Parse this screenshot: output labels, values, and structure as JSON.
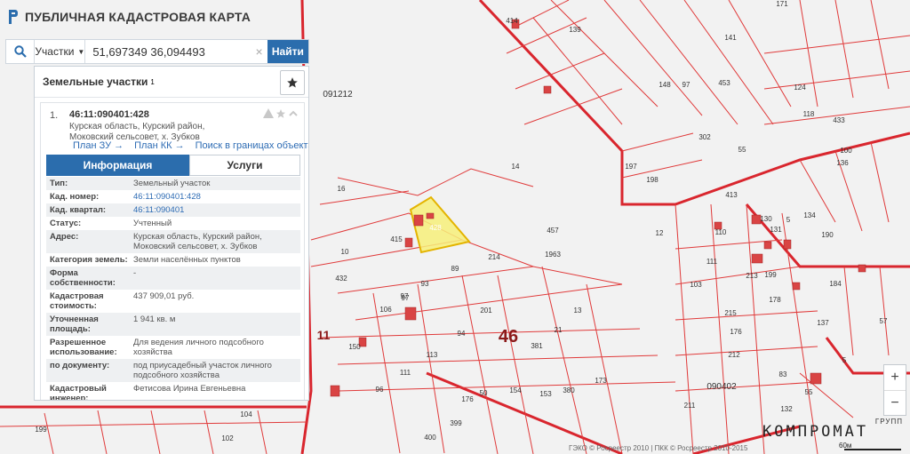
{
  "app": {
    "title": "ПУБЛИЧНАЯ КАДАСТРОВАЯ КАРТА"
  },
  "search": {
    "type_label": "Участки",
    "value": "51,697349 36,094493",
    "find_label": "Найти",
    "clear_symbol": "×"
  },
  "panel": {
    "title": "Земельные участки",
    "count": "1",
    "result": {
      "index": "1.",
      "cad_number": "46:11:090401:428",
      "address": "Курская область, Курский район, Моковский сельсовет, х. Зубков",
      "links": [
        "План ЗУ →",
        "План КК →",
        "Поиск в границах объекта →"
      ],
      "tabs": [
        "Информация",
        "Услуги"
      ],
      "rows": [
        {
          "label": "Тип:",
          "value": "Земельный участок"
        },
        {
          "label": "Кад. номер:",
          "value": "46:11:090401:428"
        },
        {
          "label": "Кад. квартал:",
          "value": "46:11:090401"
        },
        {
          "label": "Статус:",
          "value": "Учтенный"
        },
        {
          "label": "Адрес:",
          "value": "Курская область, Курский район, Моковский сельсовет, х. Зубков"
        },
        {
          "label": "Категория земель:",
          "value": "Земли населённых пунктов"
        },
        {
          "label": "Форма собственности:",
          "value": "-"
        },
        {
          "label": "Кадастровая стоимость:",
          "value": "437 909,01 руб."
        },
        {
          "label": "Уточненная площадь:",
          "value": "1 941 кв. м"
        },
        {
          "label": "Разрешенное использование:",
          "value": "Для ведения личного подсобного хозяйства"
        },
        {
          "label": "по документу:",
          "value": "под приусадебный участок личного подсобного хозяйства"
        },
        {
          "label": "Кадастровый инженер:",
          "value": "Фетисова Ирина Евгеньевна"
        }
      ]
    }
  },
  "map": {
    "quarter_labels": [
      "091212",
      "090402"
    ],
    "district_labels": [
      "46",
      "11"
    ],
    "highlight_label": "428",
    "parcel_labels": [
      "414",
      "139",
      "171",
      "141",
      "453",
      "97",
      "148",
      "55",
      "302",
      "16",
      "415",
      "10",
      "432",
      "14",
      "197",
      "198",
      "12",
      "413",
      "457",
      "89",
      "214",
      "1963",
      "13",
      "93",
      "97",
      "201",
      "94",
      "113",
      "111",
      "96",
      "50",
      "154",
      "381",
      "153",
      "380",
      "173",
      "176",
      "399",
      "104",
      "102",
      "199",
      "400",
      "211",
      "178",
      "110",
      "111",
      "103",
      "215",
      "137",
      "57",
      "5",
      "184",
      "199",
      "213",
      "176",
      "212",
      "83",
      "55",
      "132",
      "124",
      "190",
      "100",
      "433",
      "136",
      "5",
      "130",
      "131",
      "134",
      "118",
      "21",
      "150",
      "106",
      "97"
    ],
    "zoom_in": "+",
    "zoom_out": "−",
    "attribution": "ГЭКО © Росреестр 2010 | ПКК © Росреестр 2010-2015",
    "scale": "60м",
    "watermark_small": "ГРУПП",
    "watermark_big": "КОМПРОМАТ",
    "colors": {
      "background": "#efefef",
      "parcel_line": "#e03a3a",
      "quarter_line": "#d9262e",
      "highlight_fill": "#f7f07a",
      "highlight_stroke": "#e4b400",
      "building_fill": "#d94444",
      "accent": "#2b6dad"
    }
  }
}
